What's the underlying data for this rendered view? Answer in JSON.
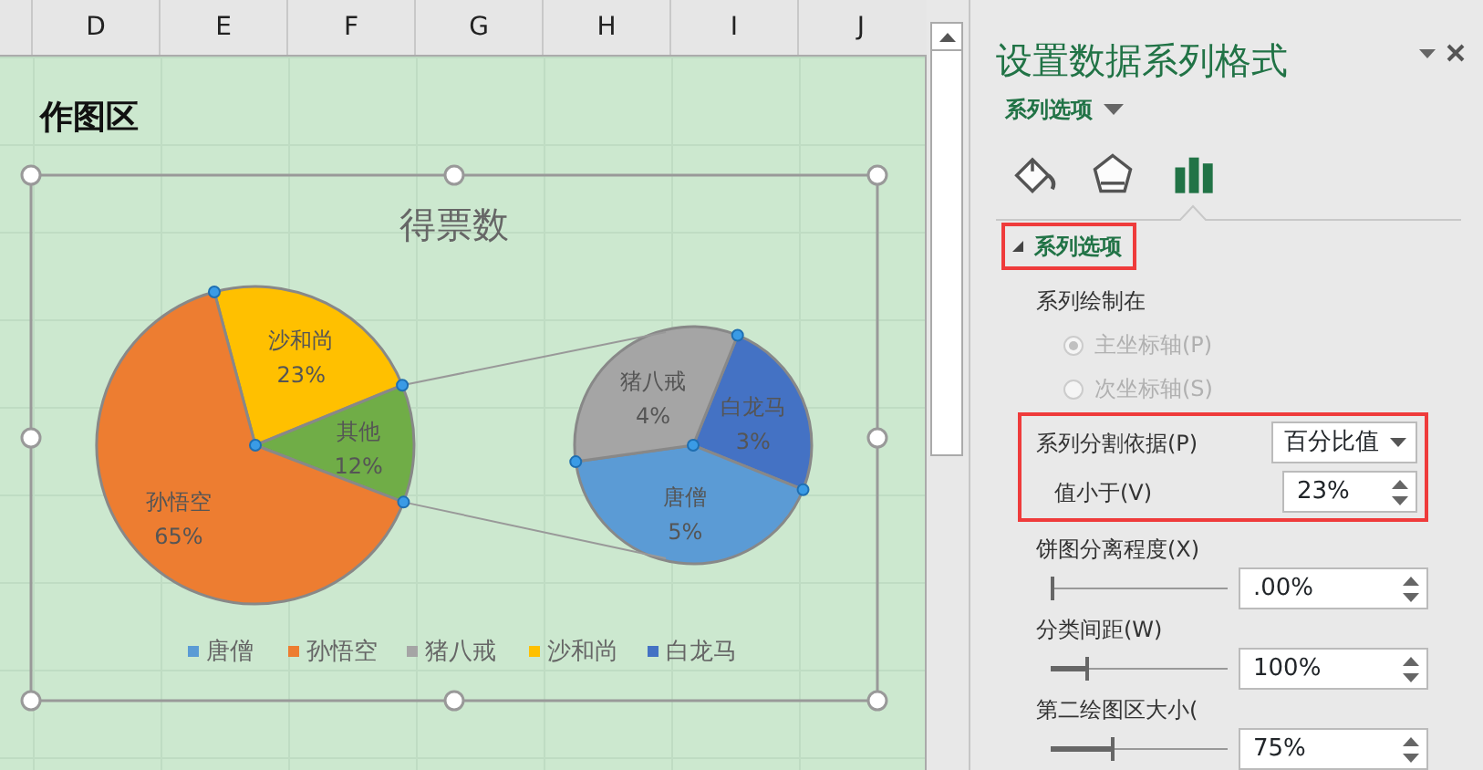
{
  "sheet": {
    "column_headers": [
      "D",
      "E",
      "F",
      "G",
      "H",
      "I",
      "J"
    ],
    "chart_area_label": "作图区",
    "chart": {
      "title": "得票数",
      "legend": [
        {
          "label": "唐僧",
          "color": "#5b9bd5"
        },
        {
          "label": "孙悟空",
          "color": "#ed7d31"
        },
        {
          "label": "猪八戒",
          "color": "#a5a5a5"
        },
        {
          "label": "沙和尚",
          "color": "#ffc000"
        },
        {
          "label": "白龙马",
          "color": "#4472c4"
        }
      ],
      "primary_pie": [
        {
          "kind": "category",
          "name": "沙和尚",
          "value_label": "23%",
          "color": "#ffc000"
        },
        {
          "kind": "other",
          "name": "其他",
          "value_label": "12%",
          "color": "#70ad47"
        },
        {
          "kind": "category",
          "name": "孙悟空",
          "value_label": "65%",
          "color": "#ed7d31"
        }
      ],
      "secondary_pie": [
        {
          "name": "白龙马",
          "value_label": "3%",
          "color": "#4472c4"
        },
        {
          "name": "唐僧",
          "value_label": "5%",
          "color": "#5b9bd5"
        },
        {
          "name": "猪八戒",
          "value_label": "4%",
          "color": "#a5a5a5"
        }
      ]
    }
  },
  "pane": {
    "title": "设置数据系列格式",
    "options_menu": "系列选项",
    "tabs": [
      {
        "kind": "fill",
        "selected": false
      },
      {
        "kind": "effects",
        "selected": false
      },
      {
        "kind": "series",
        "selected": true
      }
    ],
    "section": {
      "heading": "系列选项",
      "expanded": true
    },
    "plot_on_label": "系列绘制在",
    "radios": [
      {
        "label": "主坐标轴(P)",
        "selected": true,
        "disabled": true
      },
      {
        "label": "次坐标轴(S)",
        "selected": false,
        "disabled": true
      }
    ],
    "split_by": {
      "label": "系列分割依据(P)",
      "value": "百分比值"
    },
    "value_less_than": {
      "label": "值小于(V)",
      "value": "23%"
    },
    "sliders": [
      {
        "label": "饼图分离程度(X)",
        "level": 0,
        "value": ".00%"
      },
      {
        "label": "分类间距(W)",
        "level": 0.2,
        "value": "100%"
      },
      {
        "label": "第二绘图区大小(",
        "level": 0.34,
        "value": "75%"
      }
    ]
  }
}
